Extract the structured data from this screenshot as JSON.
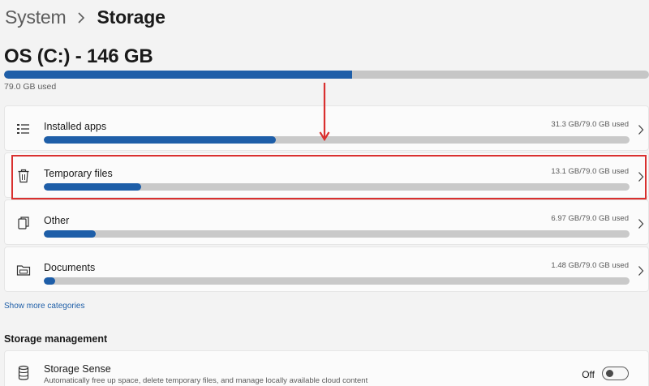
{
  "breadcrumb": {
    "parent": "System",
    "current": "Storage"
  },
  "drive": {
    "title": "OS (C:) - 146 GB",
    "used_label": "79.0 GB used",
    "used_fraction": 0.54
  },
  "categories": [
    {
      "label": "Installed apps",
      "usage": "31.3 GB/79.0 GB used",
      "fraction": 0.396,
      "icon": "apps-list-icon"
    },
    {
      "label": "Temporary files",
      "usage": "13.1 GB/79.0 GB used",
      "fraction": 0.166,
      "icon": "trash-icon"
    },
    {
      "label": "Other",
      "usage": "6.97 GB/79.0 GB used",
      "fraction": 0.088,
      "icon": "other-files-icon"
    },
    {
      "label": "Documents",
      "usage": "1.48 GB/79.0 GB used",
      "fraction": 0.019,
      "icon": "folder-icon"
    }
  ],
  "show_more": "Show more categories",
  "storage_management": {
    "title": "Storage management",
    "storage_sense": {
      "label": "Storage Sense",
      "description": "Automatically free up space, delete temporary files, and manage locally available cloud content",
      "toggle_state": "Off"
    }
  },
  "colors": {
    "accent": "#1e5ea8",
    "highlight": "#d9302f",
    "track": "#c9c9c9"
  }
}
